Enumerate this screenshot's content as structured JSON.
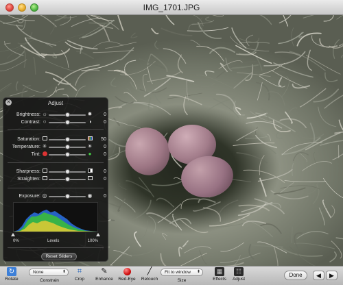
{
  "window": {
    "title": "IMG_1701.JPG"
  },
  "adjust_panel": {
    "title": "Adjust",
    "close_glyph": "✕",
    "rows": [
      {
        "label": "Brightness:",
        "value": "0",
        "level": 0.5,
        "left_icon": "sun-small-icon",
        "right_icon": "sun-large-icon"
      },
      {
        "label": "Contrast:",
        "value": "0",
        "level": 0.5,
        "left_icon": "circle-outline-icon",
        "right_icon": "half-circle-icon"
      },
      {
        "label": "Saturation:",
        "value": "50",
        "level": 0.5,
        "left_icon": "saturation-low-icon",
        "right_icon": "saturation-high-icon"
      },
      {
        "label": "Temperature:",
        "value": "0",
        "level": 0.5,
        "left_icon": "snowflake-icon",
        "right_icon": "sun-warm-icon"
      },
      {
        "label": "Tint:",
        "value": "0",
        "level": 0.5,
        "left_icon": "tint-red-icon",
        "right_icon": "tint-green-icon"
      },
      {
        "label": "Sharpness:",
        "value": "0",
        "level": 0.5,
        "left_icon": "blur-icon",
        "right_icon": "sharp-icon"
      },
      {
        "label": "Straighten:",
        "value": "0",
        "level": 0.5,
        "left_icon": "tilt-left-icon",
        "right_icon": "tilt-right-icon"
      },
      {
        "label": "Exposure:",
        "value": "0",
        "level": 0.5,
        "left_icon": "aperture-small-icon",
        "right_icon": "aperture-large-icon"
      }
    ],
    "levels": {
      "label": "Levels",
      "min_label": "0%",
      "max_label": "100%"
    },
    "reset_label": "Reset Sliders"
  },
  "toolbar": {
    "rotate": "Rotate",
    "constrain_value": "None",
    "constrain": "Constrain",
    "crop": "Crop",
    "enhance": "Enhance",
    "red_eye": "Red-Eye",
    "retouch": "Retouch",
    "size_value": "Fit to window",
    "size": "Size",
    "effects": "Effects",
    "adjust": "Adjust",
    "done": "Done",
    "prev_glyph": "◀",
    "next_glyph": "▶"
  }
}
